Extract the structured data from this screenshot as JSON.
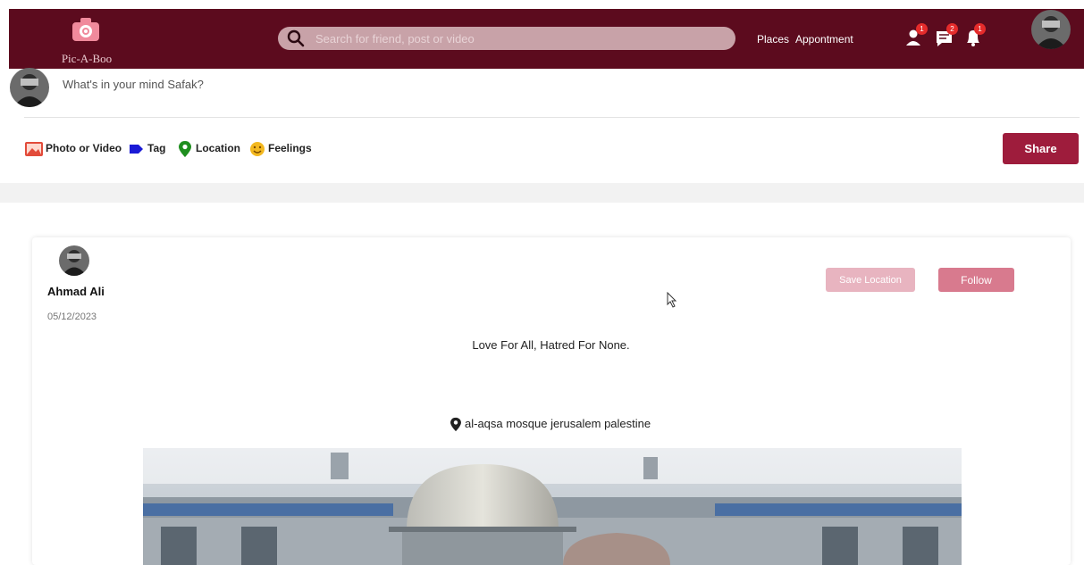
{
  "header": {
    "logo_text": "Pic-A-Boo",
    "search_placeholder": "Search for friend, post or video",
    "nav_links": [
      "Places",
      "Appontment"
    ],
    "badges": {
      "friends": "1",
      "messages": "2",
      "notifications": "1"
    }
  },
  "composer": {
    "prompt": "What's in your mind Safak?",
    "actions": {
      "photo": "Photo or Video",
      "tag": "Tag",
      "location": "Location",
      "feelings": "Feelings"
    },
    "share_label": "Share"
  },
  "post": {
    "author": "Ahmad Ali",
    "date": "05/12/2023",
    "save_location_label": "Save Location",
    "follow_label": "Follow",
    "text": "Love For All, Hatred For None.",
    "location": "al-aqsa mosque jerusalem palestine"
  },
  "colors": {
    "header_bg": "#5c0b1e",
    "share": "#9e1c3c",
    "follow": "#d87a8e",
    "save_location": "#e8b4c0",
    "badge": "#e52b2b"
  },
  "icons": [
    "camera-logo-icon",
    "search-icon",
    "friend-request-icon",
    "messages-icon",
    "notification-bell-icon",
    "photo-icon",
    "tag-icon",
    "location-pin-icon",
    "feelings-icon",
    "cursor-icon"
  ]
}
